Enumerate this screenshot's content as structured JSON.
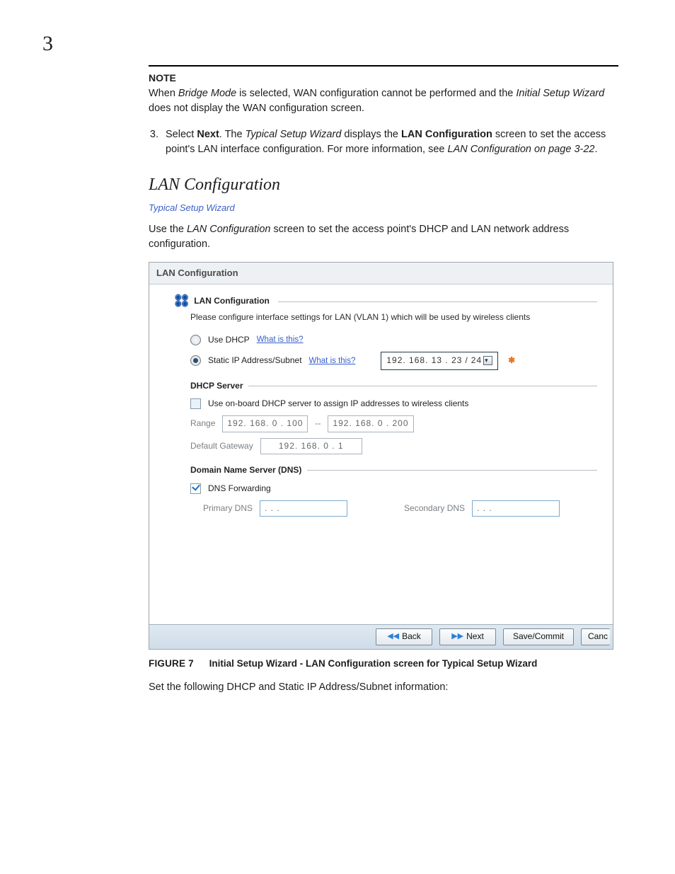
{
  "page": {
    "number": "3"
  },
  "note": {
    "heading": "NOTE",
    "body_pre": "When ",
    "body_em1": "Bridge Mode",
    "body_mid": " is selected, WAN configuration cannot be performed and the ",
    "body_em2": "Initial Setup Wizard",
    "body_post": " does not display the WAN configuration screen."
  },
  "step3": {
    "lead": "Select ",
    "next_bold": "Next",
    "after_next_1": ". The ",
    "tsw_em": "Typical Setup Wizard",
    "after_tsw": " displays the ",
    "lanconf_bold": "LAN Configuration",
    "after_lanconf": " screen to set the access point's LAN interface configuration. For more information, see ",
    "xref_em": "LAN Configuration on page 3-22",
    "end": "."
  },
  "section": {
    "title": "LAN Configuration",
    "sublink": "Typical Setup Wizard",
    "intro_pre": "Use the ",
    "intro_em": "LAN Configuration",
    "intro_post": " screen to set the access point's DHCP and LAN network address configuration."
  },
  "wizard": {
    "title": "LAN Configuration",
    "fieldset_title": "LAN Configuration",
    "desc": "Please configure interface settings for LAN (VLAN 1) which will be used by wireless clients",
    "use_dhcp_label": "Use DHCP",
    "what_is_this": "What is this?",
    "static_ip_label": "Static IP Address/Subnet",
    "static_ip_value": "192. 168.  13 .  23",
    "subnet_value": "24",
    "dhcp_server": {
      "heading": "DHCP Server",
      "onboard_label": "Use on-board DHCP server to assign IP addresses to wireless clients",
      "range_label": "Range",
      "range_start": "192. 168.   0  . 100",
      "range_sep": "--",
      "range_end": "192. 168.   0  . 200",
      "gateway_label": "Default Gateway",
      "gateway_value": "192. 168.   0  .   1"
    },
    "dns": {
      "heading": "Domain Name Server (DNS)",
      "forwarding_label": "DNS Forwarding",
      "primary_label": "Primary DNS",
      "primary_value": "   .      .      .   ",
      "secondary_label": "Secondary DNS",
      "secondary_value": "   .     .      .   "
    },
    "buttons": {
      "back": "Back",
      "next": "Next",
      "save": "Save/Commit",
      "cancel": "Canc"
    }
  },
  "figure": {
    "num": "FIGURE 7",
    "caption": "Initial Setup Wizard - LAN Configuration screen for Typical Setup Wizard"
  },
  "closing": "Set the following DHCP and Static IP Address/Subnet information:"
}
